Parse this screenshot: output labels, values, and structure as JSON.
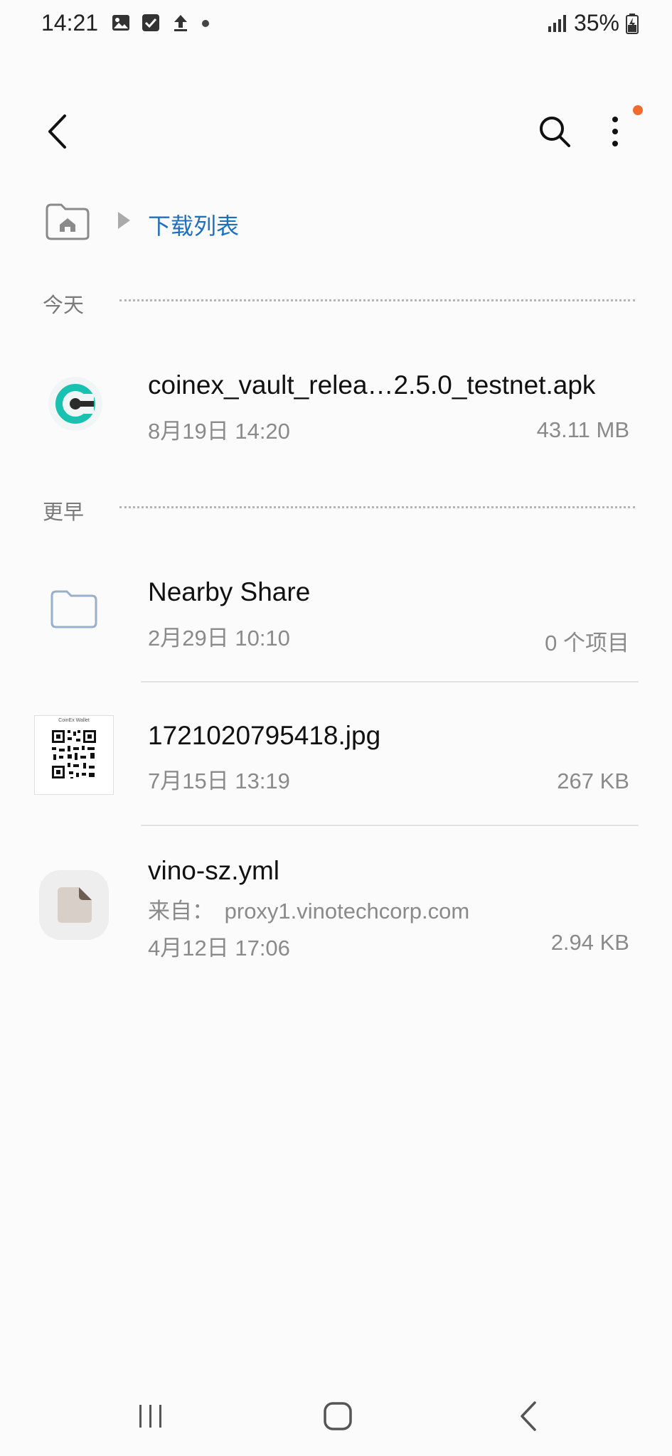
{
  "status_bar": {
    "time": "14:21",
    "notification_icons": [
      "image-icon",
      "checkbox-icon",
      "upload-icon",
      "dot-icon"
    ],
    "battery_percent": "35%"
  },
  "toolbar": {
    "back_icon": "back-arrow-icon",
    "search_icon": "search-icon",
    "more_icon": "more-vertical-icon",
    "notification_dot_color": "#f26a2e"
  },
  "breadcrumb": {
    "home_icon": "home-folder-icon",
    "current": "下载列表"
  },
  "sections": [
    {
      "header": "今天",
      "items": [
        {
          "name": "coinex_vault_relea…2.5.0_testnet.apk",
          "date": "8月19日 14:20",
          "size": "43.11 MB",
          "icon": "coinex-app-icon"
        }
      ]
    },
    {
      "header": "更早",
      "items": [
        {
          "name": "Nearby Share",
          "date": "2月29日 10:10",
          "size": "0 个项目",
          "icon": "folder-icon"
        },
        {
          "name": "1721020795418.jpg",
          "date": "7月15日 13:19",
          "size": "267 KB",
          "icon": "qr-thumbnail"
        },
        {
          "name": "vino-sz.yml",
          "source_label": "来自：",
          "source": "proxy1.vinotechcorp.com",
          "date": "4月12日 17:06",
          "size": "2.94 KB",
          "icon": "document-icon"
        }
      ]
    }
  ],
  "qr_caption": "CoinEx Wallet",
  "nav_bar": [
    "recents-icon",
    "home-icon",
    "back-icon"
  ],
  "colors": {
    "accent": "#1f6fbf",
    "coinex": "#19c2b0"
  }
}
